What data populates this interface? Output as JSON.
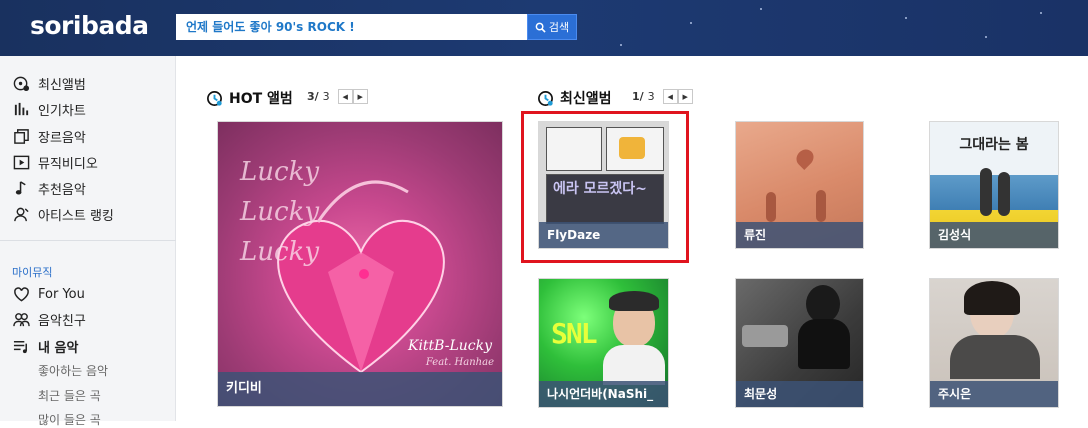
{
  "header": {
    "logo": "soribada",
    "search_value": "언제 들어도 좋아 90's ROCK !",
    "search_button": "검색"
  },
  "sidebar": {
    "main_items": [
      {
        "label": "최신앨범",
        "icon": "disc-new-icon"
      },
      {
        "label": "인기차트",
        "icon": "bar-chart-icon"
      },
      {
        "label": "장르음악",
        "icon": "stack-icon"
      },
      {
        "label": "뮤직비디오",
        "icon": "play-icon"
      },
      {
        "label": "추천음악",
        "icon": "music-note-icon"
      },
      {
        "label": "아티스트 랭킹",
        "icon": "artist-icon"
      }
    ],
    "section_title": "마이뮤직",
    "my_items": [
      {
        "label": "For You",
        "icon": "heart-icon"
      },
      {
        "label": "음악친구",
        "icon": "friends-icon"
      },
      {
        "label": "내 음악",
        "icon": "playlist-icon"
      }
    ],
    "sub_items": [
      "좋아하는 음악",
      "최근 들은 곡",
      "많이 들은 곡"
    ]
  },
  "hot": {
    "title": "HOT 앨범",
    "page_current": "3/",
    "page_total": "3",
    "album": {
      "caption": "키디비",
      "art_text": "Lucky Lucky Lucky",
      "art_sign": "KittB-Lucky",
      "art_feat": "Feat. Hanhae"
    }
  },
  "latest": {
    "title": "최신앨범",
    "page_current": "1/",
    "page_total": "3",
    "albums": [
      {
        "caption": "FlyDaze",
        "art_text": "에라 모르겠다~"
      },
      {
        "caption": "류진"
      },
      {
        "caption": "김성식",
        "art_text": "그대라는 봄"
      },
      {
        "caption": "나시언더바(NaShi_",
        "art_text": "SNL"
      },
      {
        "caption": "최문성"
      },
      {
        "caption": "주시은"
      }
    ]
  },
  "colors": {
    "header": "#1d3a72",
    "accent": "#2b6fd6",
    "highlight": "#e0141e"
  }
}
